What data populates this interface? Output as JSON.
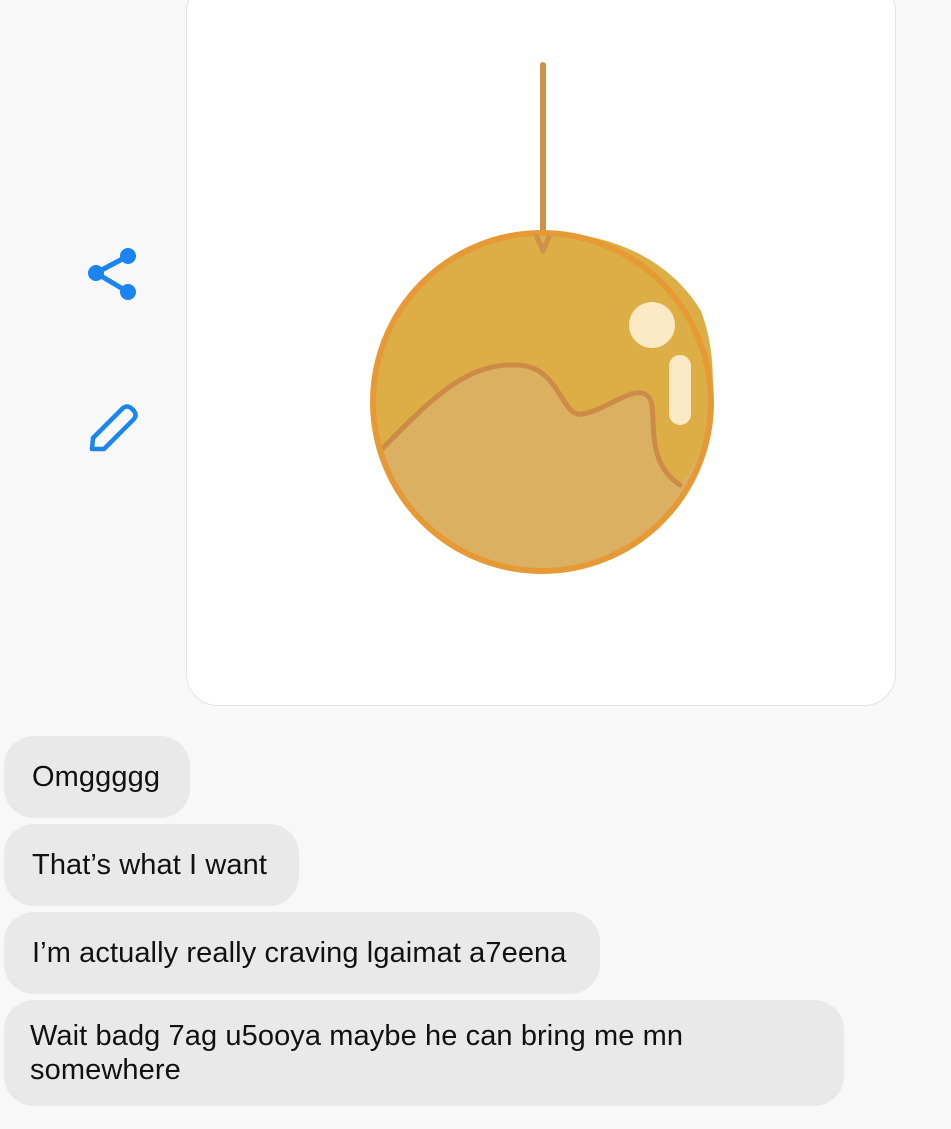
{
  "actions": {
    "share_icon": "share-icon",
    "edit_icon": "pencil-icon",
    "accent_color": "#1a84f0"
  },
  "image": {
    "subject": "candy-apple-sticker",
    "colors": {
      "outline": "#e69a36",
      "top": "#ddae46",
      "bottom": "#dbb063",
      "stick": "#cf914a",
      "highlight": "#fbe9c5"
    }
  },
  "messages": [
    {
      "text": "Omggggg"
    },
    {
      "text": "That’s what I want"
    },
    {
      "text": "I’m actually really craving lgaimat a7eena"
    },
    {
      "text": "Wait badg 7ag u5ooya maybe he can bring me mn somewhere"
    }
  ]
}
